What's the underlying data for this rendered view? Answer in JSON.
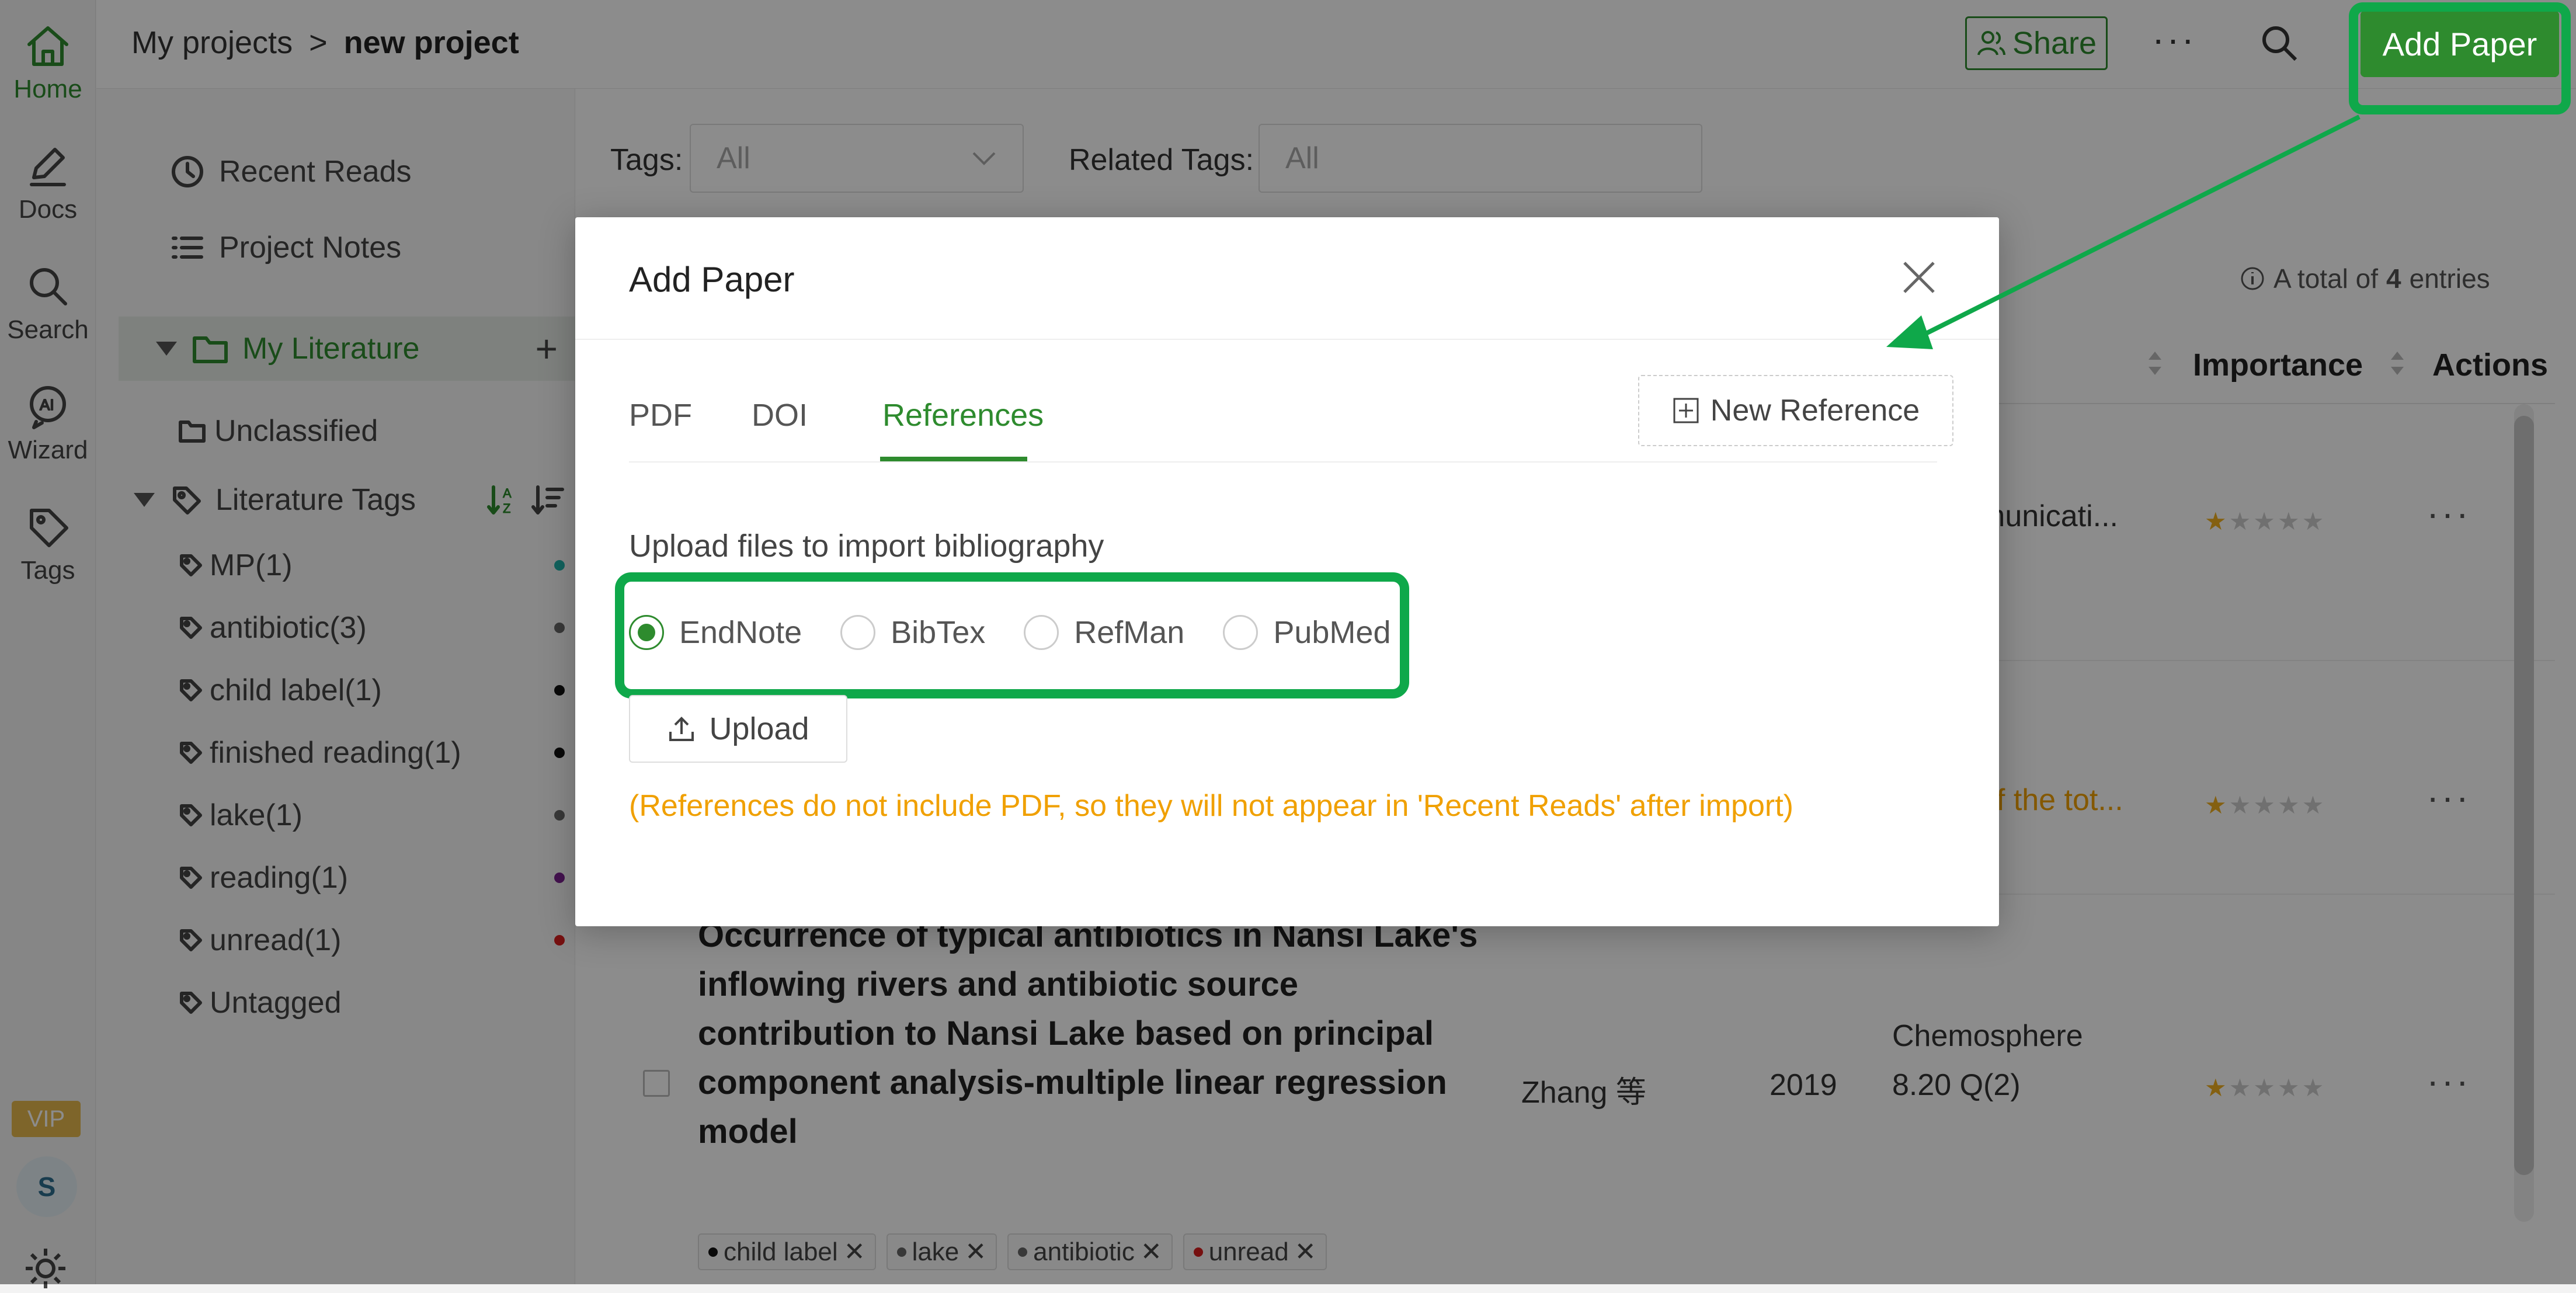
{
  "rail": {
    "items": [
      {
        "label": "Home",
        "icon": "home-icon",
        "active": true
      },
      {
        "label": "Docs",
        "icon": "pen-icon"
      },
      {
        "label": "Search",
        "icon": "search-icon"
      },
      {
        "label": "Wizard",
        "icon": "ai-icon",
        "badge": "AI"
      },
      {
        "label": "Tags",
        "icon": "tag-icon"
      }
    ],
    "vip": "VIP",
    "avatar": "S"
  },
  "topbar": {
    "breadcrumb_root": "My projects",
    "breadcrumb_sep": ">",
    "breadcrumb_current": "new project",
    "share_label": "Share",
    "more_label": "···",
    "add_paper_label": "Add Paper"
  },
  "sidebar": {
    "recent_reads": "Recent Reads",
    "project_notes": "Project Notes",
    "my_literature": "My Literature",
    "add": "+",
    "unclassified": "Unclassified",
    "literature_tags": "Literature Tags",
    "tags": [
      {
        "label": "MP(1)",
        "color": "#20b2aa"
      },
      {
        "label": "antibiotic(3)",
        "color": "#666666"
      },
      {
        "label": "child label(1)",
        "color": "#111111"
      },
      {
        "label": "finished reading(1)",
        "color": "#111111"
      },
      {
        "label": "lake(1)",
        "color": "#666666"
      },
      {
        "label": "reading(1)",
        "color": "#7b1f8f"
      },
      {
        "label": "unread(1)",
        "color": "#d81e1e"
      }
    ],
    "untagged": "Untagged"
  },
  "main": {
    "tags_label": "Tags:",
    "tags_value": "All",
    "related_tags_label": "Related Tags:",
    "related_tags_placeholder": "All",
    "total_prefix": "A total of",
    "total_count": "4",
    "total_suffix": "entries",
    "col_importance": "Importance",
    "col_actions": "Actions",
    "rows": [
      {
        "journal": "municati...",
        "more": "···"
      },
      {
        "journal": "of the tot...",
        "more": "···"
      },
      {
        "title": "Occurrence of typical antibiotics in Nansi Lake's inflowing rivers and antibiotic source contribution to Nansi Lake based on principal component analysis-multiple linear regression model",
        "author": "Zhang 等",
        "year": "2019",
        "journal": "Chemosphere",
        "impact": "8.20 Q(2)",
        "more": "···",
        "tags": [
          {
            "label": "child label",
            "color": "#111111"
          },
          {
            "label": "lake",
            "color": "#666666"
          },
          {
            "label": "antibiotic",
            "color": "#666666"
          },
          {
            "label": "unread",
            "color": "#d81e1e"
          }
        ]
      }
    ]
  },
  "modal": {
    "title": "Add Paper",
    "tabs": [
      {
        "label": "PDF"
      },
      {
        "label": "DOI"
      },
      {
        "label": "References",
        "active": true
      }
    ],
    "new_reference": "New Reference",
    "upload_label": "Upload files to import bibliography",
    "formats": [
      {
        "label": "EndNote",
        "checked": true
      },
      {
        "label": "BibTex"
      },
      {
        "label": "RefMan"
      },
      {
        "label": "PubMed"
      }
    ],
    "upload_button": "Upload",
    "note": "(References do not include PDF, so they will not appear in 'Recent Reads' after import)"
  },
  "colors": {
    "brand": "#2e8b2e",
    "highlight": "#0fa84a",
    "note": "#f0a000"
  }
}
